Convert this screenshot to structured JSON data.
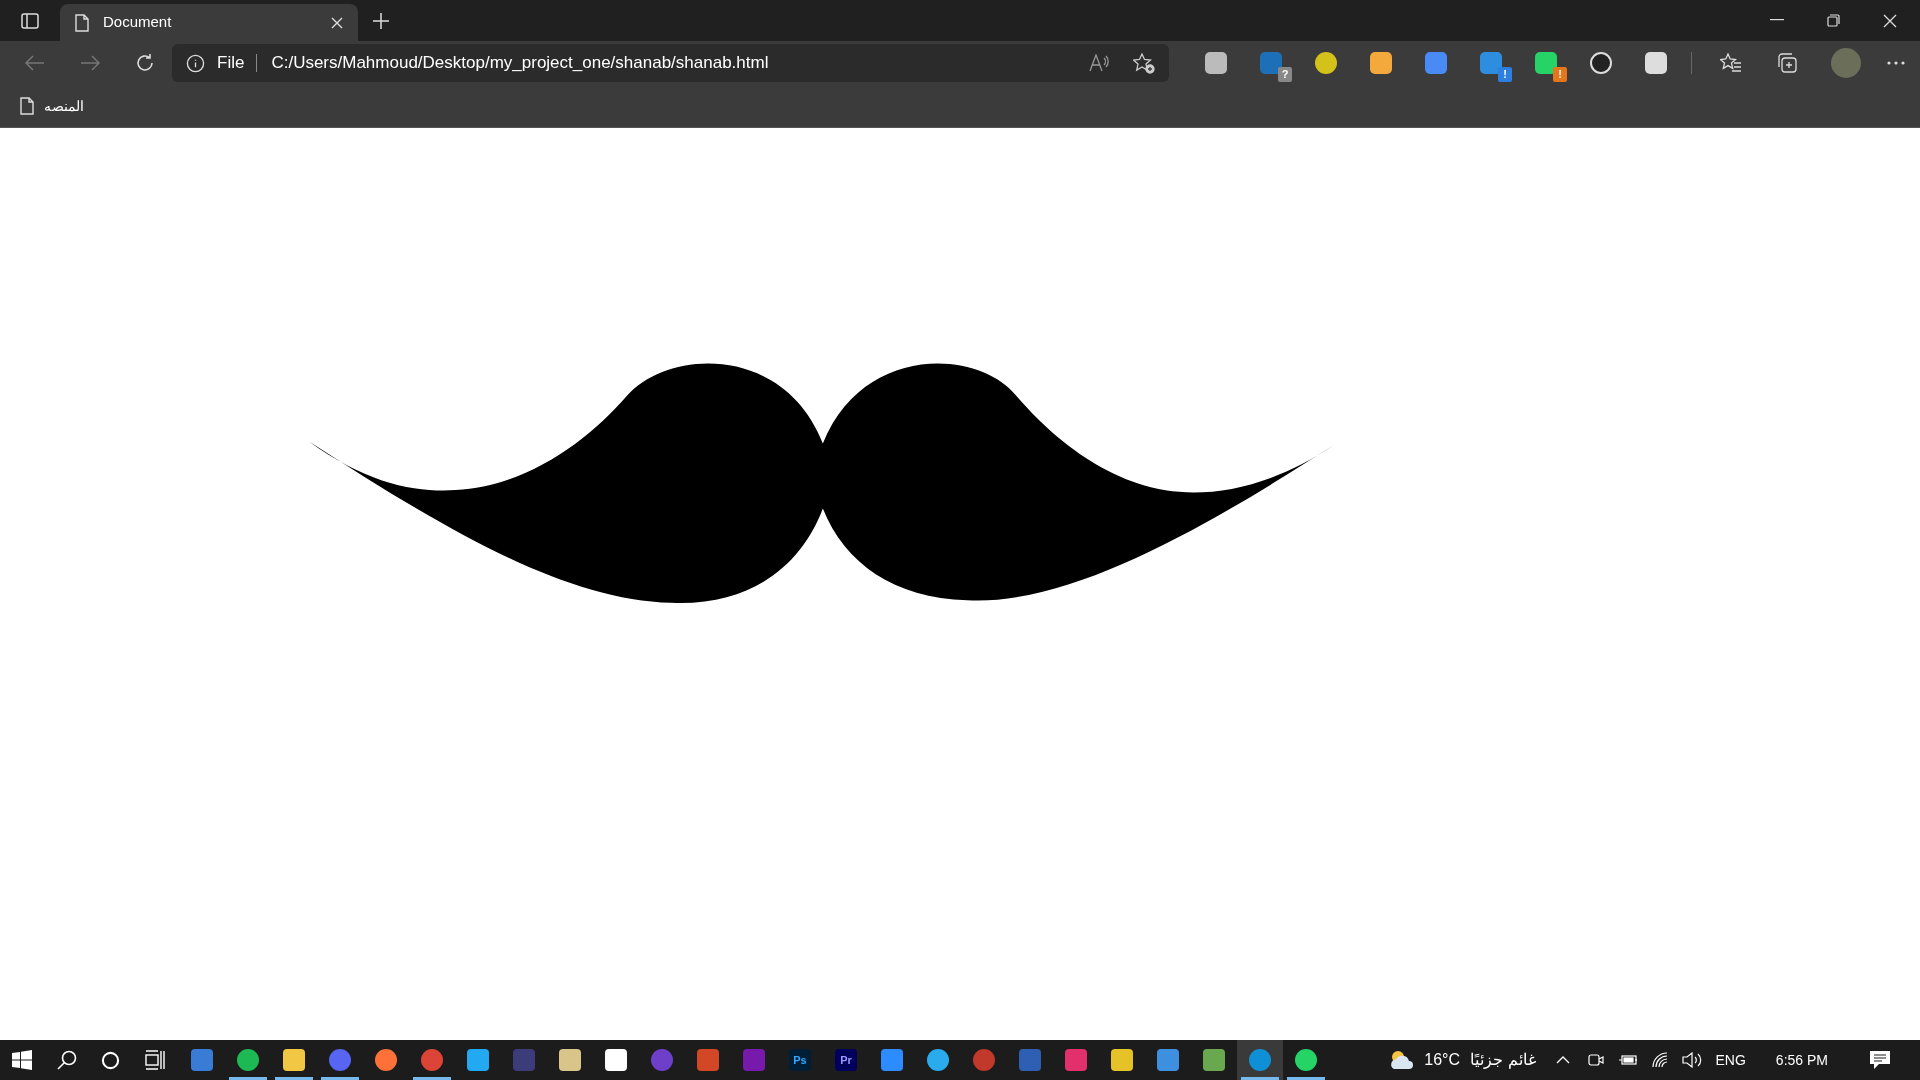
{
  "tab": {
    "title": "Document",
    "selected": true
  },
  "address_bar": {
    "scheme": "File",
    "url": "C:/Users/Mahmoud/Desktop/my_project_one/shanab/shanab.html"
  },
  "extension_badges": [
    "?",
    "!",
    "!"
  ],
  "bookmarks": [
    {
      "label": "المنصه"
    }
  ],
  "taskbar": {
    "apps": [
      {
        "running": false
      },
      {
        "running": true
      },
      {
        "running": true
      },
      {
        "running": true
      },
      {
        "running": false
      },
      {
        "running": true
      },
      {
        "running": false
      },
      {
        "running": false
      },
      {
        "running": false
      },
      {
        "running": false
      },
      {
        "running": false
      },
      {
        "running": false
      },
      {
        "running": false
      },
      {
        "label": "Ps",
        "running": false
      },
      {
        "label": "Pr",
        "running": false
      },
      {
        "running": false
      },
      {
        "running": false
      },
      {
        "running": false
      },
      {
        "running": false
      },
      {
        "running": false
      },
      {
        "running": false
      },
      {
        "running": false
      },
      {
        "running": false
      },
      {
        "running": true,
        "selected": true
      },
      {
        "running": true
      }
    ],
    "weather": {
      "temperature": "16°C",
      "condition": "غائم جزئيًا"
    },
    "language": "ENG",
    "time": "6:56 PM"
  }
}
